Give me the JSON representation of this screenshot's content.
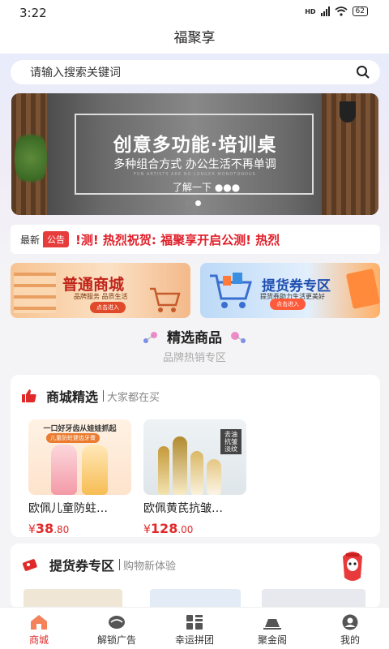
{
  "status": {
    "time": "3:22",
    "network": "HD",
    "battery": "62"
  },
  "header": {
    "title": "福聚享"
  },
  "search": {
    "placeholder": "请输入搜索关键词",
    "icon": "search-icon"
  },
  "banner": {
    "headline": "创意多功能·培训桌",
    "subline": "多种组合方式 办公生活不再单调",
    "tagline": "FUN ARTISTS ARE NO LONGER MONOTONOUS",
    "more": "了解一下 ●●●",
    "slides": 2,
    "active_slide": 2
  },
  "notice": {
    "latest": "最新",
    "tag": "公告",
    "text": "!测! 热烈祝贺: 福聚享开启公测! 热烈"
  },
  "promos": [
    {
      "title": "普通商城",
      "subtitle": "品牌服务 品质生活",
      "button": "点击进入"
    },
    {
      "title": "提货券专区",
      "subtitle": "提货券助力生活更美好",
      "button": "点击进入"
    }
  ],
  "featured": {
    "title": "精选商品",
    "subtitle": "品牌热销专区"
  },
  "mall_section": {
    "title": "商城精选",
    "subtitle": "大家都在买",
    "products": [
      {
        "name": "欧佩儿童防蛀…",
        "currency": "¥",
        "price_int": "38",
        "price_dec": ".80",
        "img_text": "一口好牙齿从娃娃抓起",
        "img_pill": "儿童防蛀健齿牙膏"
      },
      {
        "name": "欧佩黄芪抗皱…",
        "currency": "¥",
        "price_int": "128",
        "price_dec": ".00",
        "img_text": "去油 抗皱 淡纹",
        "img_pill": "OKADI"
      }
    ]
  },
  "voucher_section": {
    "title": "提货券专区",
    "subtitle": "购物新体验"
  },
  "tabs": [
    {
      "label": "商城",
      "icon": "home-icon",
      "active": true
    },
    {
      "label": "解锁广告",
      "icon": "ad-icon",
      "active": false
    },
    {
      "label": "幸运拼团",
      "icon": "group-icon",
      "active": false
    },
    {
      "label": "聚金阁",
      "icon": "gold-icon",
      "active": false
    },
    {
      "label": "我的",
      "icon": "profile-icon",
      "active": false
    }
  ],
  "colors": {
    "accent": "#e02a2a",
    "blue": "#1e4fb0"
  }
}
